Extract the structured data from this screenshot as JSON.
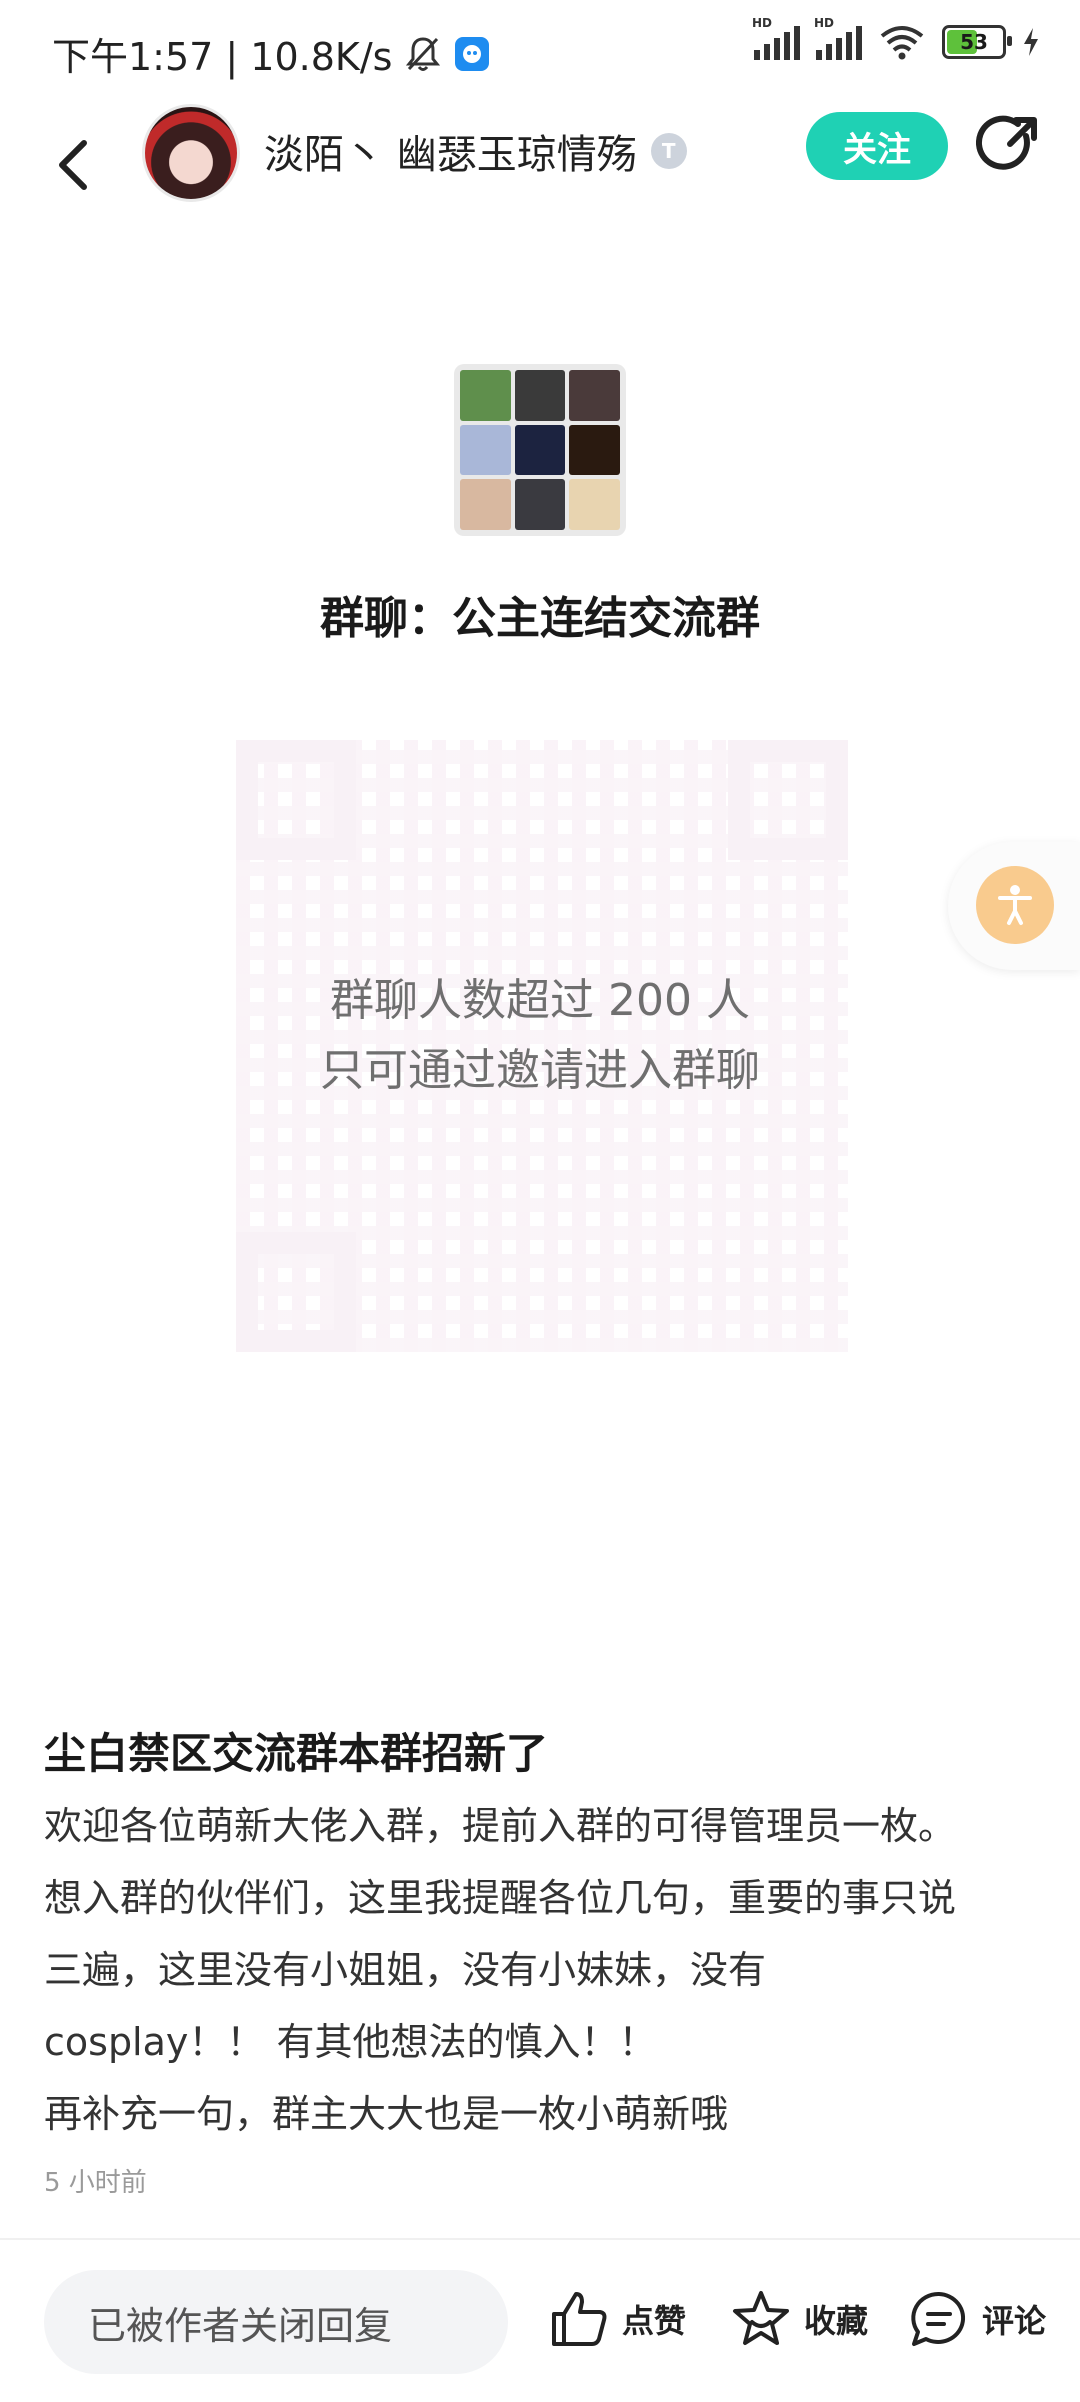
{
  "status_bar": {
    "time_speed": "下午1:57 | 10.8K/s",
    "battery": "53"
  },
  "header": {
    "author_name": "淡陌丶 幽瑟玉琼情殇",
    "level_badge": "T",
    "follow_label": "关注"
  },
  "group": {
    "name": "群聊：公主连结交流群",
    "notice_line1": "群聊人数超过 200 人",
    "notice_line2": "只可通过邀请进入群聊"
  },
  "post": {
    "title": "尘白禁区交流群本群招新了",
    "lines": [
      "欢迎各位萌新大佬入群，提前入群的可得管理员一枚。",
      "想入群的伙伴们，这里我提醒各位几句，重要的事只说",
      "三遍，这里没有小姐姐，没有小妹妹，没有",
      "cosplay！！ 有其他想法的慎入！！",
      "再补充一句，群主大大也是一枚小萌新哦"
    ],
    "time": "5 小时前"
  },
  "bottom_bar": {
    "reply_placeholder": "已被作者关闭回复",
    "like_label": "点赞",
    "favorite_label": "收藏",
    "comment_label": "评论"
  }
}
